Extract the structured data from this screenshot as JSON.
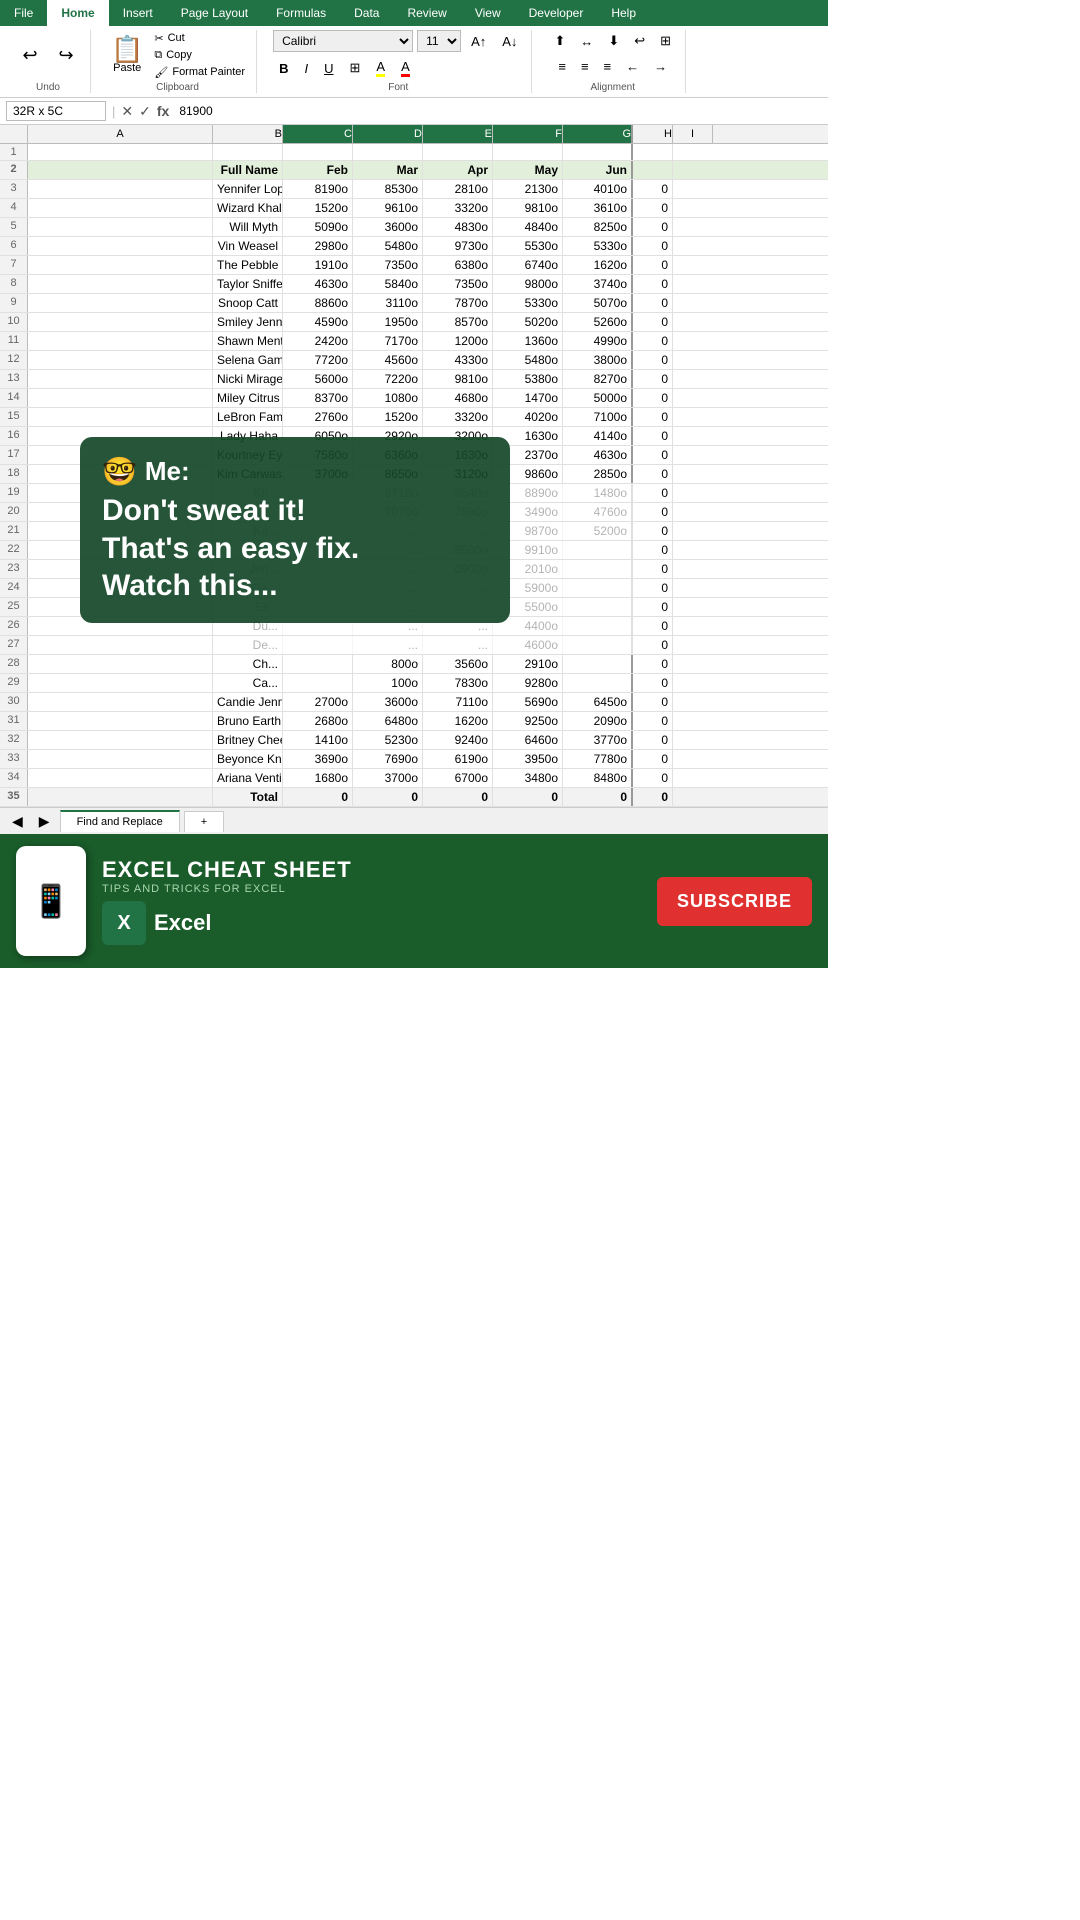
{
  "tabs": [
    "File",
    "Home",
    "Insert",
    "Page Layout",
    "Formulas",
    "Data",
    "Review",
    "View",
    "Developer",
    "Help"
  ],
  "active_tab": "Home",
  "ribbon": {
    "undo_label": "Undo",
    "cut_label": "Cut",
    "copy_label": "Copy",
    "paste_label": "Paste",
    "format_painter_label": "Format Painter",
    "clipboard_label": "Clipboard",
    "font_name": "Calibri",
    "font_size": "11",
    "bold": "B",
    "italic": "I",
    "underline": "U",
    "font_label": "Font",
    "alignment_label": "Alignment"
  },
  "formula_bar": {
    "name_box": "32R x 5C",
    "formula_value": "81900"
  },
  "col_headers": [
    "A",
    "B",
    "C",
    "D",
    "E",
    "F",
    "G",
    "H",
    "I"
  ],
  "col_labels": [
    "",
    "Full Name",
    "Feb",
    "Mar",
    "Apr",
    "May",
    "Jun",
    "",
    ""
  ],
  "rows": [
    {
      "num": 1,
      "a": "",
      "b": "",
      "c": "",
      "d": "",
      "e": "",
      "f": "",
      "g": "",
      "h": ""
    },
    {
      "num": 2,
      "a": "",
      "b": "Full Name",
      "c": "Feb",
      "d": "Mar",
      "e": "Apr",
      "f": "May",
      "g": "Jun",
      "h": "",
      "header": true
    },
    {
      "num": 3,
      "a": "",
      "b": "Yennifer Lopez",
      "c": "8190o",
      "d": "8530o",
      "e": "2810o",
      "f": "2130o",
      "g": "4010o",
      "h": "0"
    },
    {
      "num": 4,
      "a": "",
      "b": "Wizard Khalifa",
      "c": "1520o",
      "d": "9610o",
      "e": "3320o",
      "f": "9810o",
      "g": "3610o",
      "h": "0"
    },
    {
      "num": 5,
      "a": "",
      "b": "Will Myth",
      "c": "5090o",
      "d": "3600o",
      "e": "4830o",
      "f": "4840o",
      "g": "8250o",
      "h": "0"
    },
    {
      "num": 6,
      "a": "",
      "b": "Vin Weasel",
      "c": "2980o",
      "d": "5480o",
      "e": "9730o",
      "f": "5530o",
      "g": "5330o",
      "h": "0"
    },
    {
      "num": 7,
      "a": "",
      "b": "The Pebble",
      "c": "1910o",
      "d": "7350o",
      "e": "6380o",
      "f": "6740o",
      "g": "1620o",
      "h": "0"
    },
    {
      "num": 8,
      "a": "",
      "b": "Taylor Sniffed",
      "c": "4630o",
      "d": "5840o",
      "e": "7350o",
      "f": "9800o",
      "g": "3740o",
      "h": "0"
    },
    {
      "num": 9,
      "a": "",
      "b": "Snoop Catt",
      "c": "8860o",
      "d": "3110o",
      "e": "7870o",
      "f": "5330o",
      "g": "5070o",
      "h": "0"
    },
    {
      "num": 10,
      "a": "",
      "b": "Smiley Jenner",
      "c": "4590o",
      "d": "1950o",
      "e": "8570o",
      "f": "5020o",
      "g": "5260o",
      "h": "0"
    },
    {
      "num": 11,
      "a": "",
      "b": "Shawn Mentos",
      "c": "2420o",
      "d": "7170o",
      "e": "1200o",
      "f": "1360o",
      "g": "4990o",
      "h": "0"
    },
    {
      "num": 12,
      "a": "",
      "b": "Selena Gamez",
      "c": "7720o",
      "d": "4560o",
      "e": "4330o",
      "f": "5480o",
      "g": "3800o",
      "h": "0"
    },
    {
      "num": 13,
      "a": "",
      "b": "Nicki Mirage",
      "c": "5600o",
      "d": "7220o",
      "e": "9810o",
      "f": "5380o",
      "g": "8270o",
      "h": "0"
    },
    {
      "num": 14,
      "a": "",
      "b": "Miley Citrus",
      "c": "8370o",
      "d": "1080o",
      "e": "4680o",
      "f": "1470o",
      "g": "5000o",
      "h": "0"
    },
    {
      "num": 15,
      "a": "",
      "b": "LeBron Fames",
      "c": "2760o",
      "d": "1520o",
      "e": "3320o",
      "f": "4020o",
      "g": "7100o",
      "h": "0"
    },
    {
      "num": 16,
      "a": "",
      "b": "Lady Haha",
      "c": "6050o",
      "d": "2920o",
      "e": "3200o",
      "f": "1630o",
      "g": "4140o",
      "h": "0"
    },
    {
      "num": 17,
      "a": "",
      "b": "Kourtney Eyelashian",
      "c": "7580o",
      "d": "6360o",
      "e": "1630o",
      "f": "2370o",
      "g": "4630o",
      "h": "0"
    },
    {
      "num": 18,
      "a": "",
      "b": "Kim Carwashian",
      "c": "3700o",
      "d": "8650o",
      "e": "3120o",
      "f": "9860o",
      "g": "2850o",
      "h": "0"
    },
    {
      "num": 19,
      "a": "",
      "b": "Kh...",
      "c": "",
      "d": "9710o",
      "e": "8540o",
      "f": "8890o",
      "g": "1480o",
      "h": "0",
      "overlay": true
    },
    {
      "num": 20,
      "a": "",
      "b": "Ke...",
      "c": "",
      "d": "7070o",
      "e": "7590o",
      "f": "3490o",
      "g": "4760o",
      "h": "0",
      "overlay": true
    },
    {
      "num": 21,
      "a": "",
      "b": "Ka...",
      "c": "",
      "d": "...",
      "e": "...",
      "f": "9870o",
      "g": "5200o",
      "h": "0",
      "overlay": true
    },
    {
      "num": 22,
      "a": "",
      "b": "Jus...",
      "c": "",
      "d": "...",
      "e": "8500o",
      "f": "9910o",
      "g": "",
      "h": "0",
      "overlay": true
    },
    {
      "num": 23,
      "a": "",
      "b": "Jim...",
      "c": "",
      "d": "...",
      "e": "0900o",
      "f": "2010o",
      "g": "",
      "h": "0",
      "overlay": true
    },
    {
      "num": 24,
      "a": "",
      "b": "Ga...",
      "c": "",
      "d": "...",
      "e": "...",
      "f": "5900o",
      "g": "",
      "h": "0",
      "overlay": true
    },
    {
      "num": 25,
      "a": "",
      "b": "Ell...",
      "c": "",
      "d": "...",
      "e": "...",
      "f": "5500o",
      "g": "",
      "h": "0",
      "overlay": true
    },
    {
      "num": 26,
      "a": "",
      "b": "Du...",
      "c": "",
      "d": "...",
      "e": "...",
      "f": "4400o",
      "g": "",
      "h": "0",
      "overlay": true
    },
    {
      "num": 27,
      "a": "",
      "b": "De...",
      "c": "",
      "d": "...",
      "e": "...",
      "f": "4600o",
      "g": "",
      "h": "0",
      "overlay": true
    },
    {
      "num": 28,
      "a": "",
      "b": "Ch...",
      "c": "",
      "d": "800o",
      "e": "3560o",
      "f": "2910o",
      "g": "",
      "h": "0"
    },
    {
      "num": 29,
      "a": "",
      "b": "Ca...",
      "c": "",
      "d": "100o",
      "e": "7830o",
      "f": "9280o",
      "g": "",
      "h": "0"
    },
    {
      "num": 30,
      "a": "",
      "b": "Candie Jenner",
      "c": "2700o",
      "d": "3600o",
      "e": "7110o",
      "f": "5690o",
      "g": "6450o",
      "h": "0"
    },
    {
      "num": 31,
      "a": "",
      "b": "Bruno Earth",
      "c": "2680o",
      "d": "6480o",
      "e": "1620o",
      "f": "9250o",
      "g": "2090o",
      "h": "0"
    },
    {
      "num": 32,
      "a": "",
      "b": "Britney Cheers",
      "c": "1410o",
      "d": "5230o",
      "e": "9240o",
      "f": "6460o",
      "g": "3770o",
      "h": "0"
    },
    {
      "num": 33,
      "a": "",
      "b": "Beyonce Knows",
      "c": "3690o",
      "d": "7690o",
      "e": "6190o",
      "f": "3950o",
      "g": "7780o",
      "h": "0"
    },
    {
      "num": 34,
      "a": "",
      "b": "Ariana Venti",
      "c": "1680o",
      "d": "3700o",
      "e": "6700o",
      "f": "3480o",
      "g": "8480o",
      "h": "0"
    },
    {
      "num": 35,
      "a": "",
      "b": "Total",
      "c": "0",
      "d": "0",
      "e": "0",
      "f": "0",
      "g": "0",
      "h": "0",
      "total": true
    }
  ],
  "overlay": {
    "emoji": "🤓",
    "me_label": "Me:",
    "line1": "Don't sweat it!",
    "line2": "That's an easy fix.",
    "line3": "Watch this..."
  },
  "sheet_tabs": [
    "Find and Replace",
    "+"
  ],
  "banner": {
    "title": "EXCEL CHEAT SHEET",
    "subtitle": "TIPS AND TRICKS FOR EXCEL",
    "excel_label": "Excel",
    "subscribe_label": "SUBSCRIBE"
  }
}
